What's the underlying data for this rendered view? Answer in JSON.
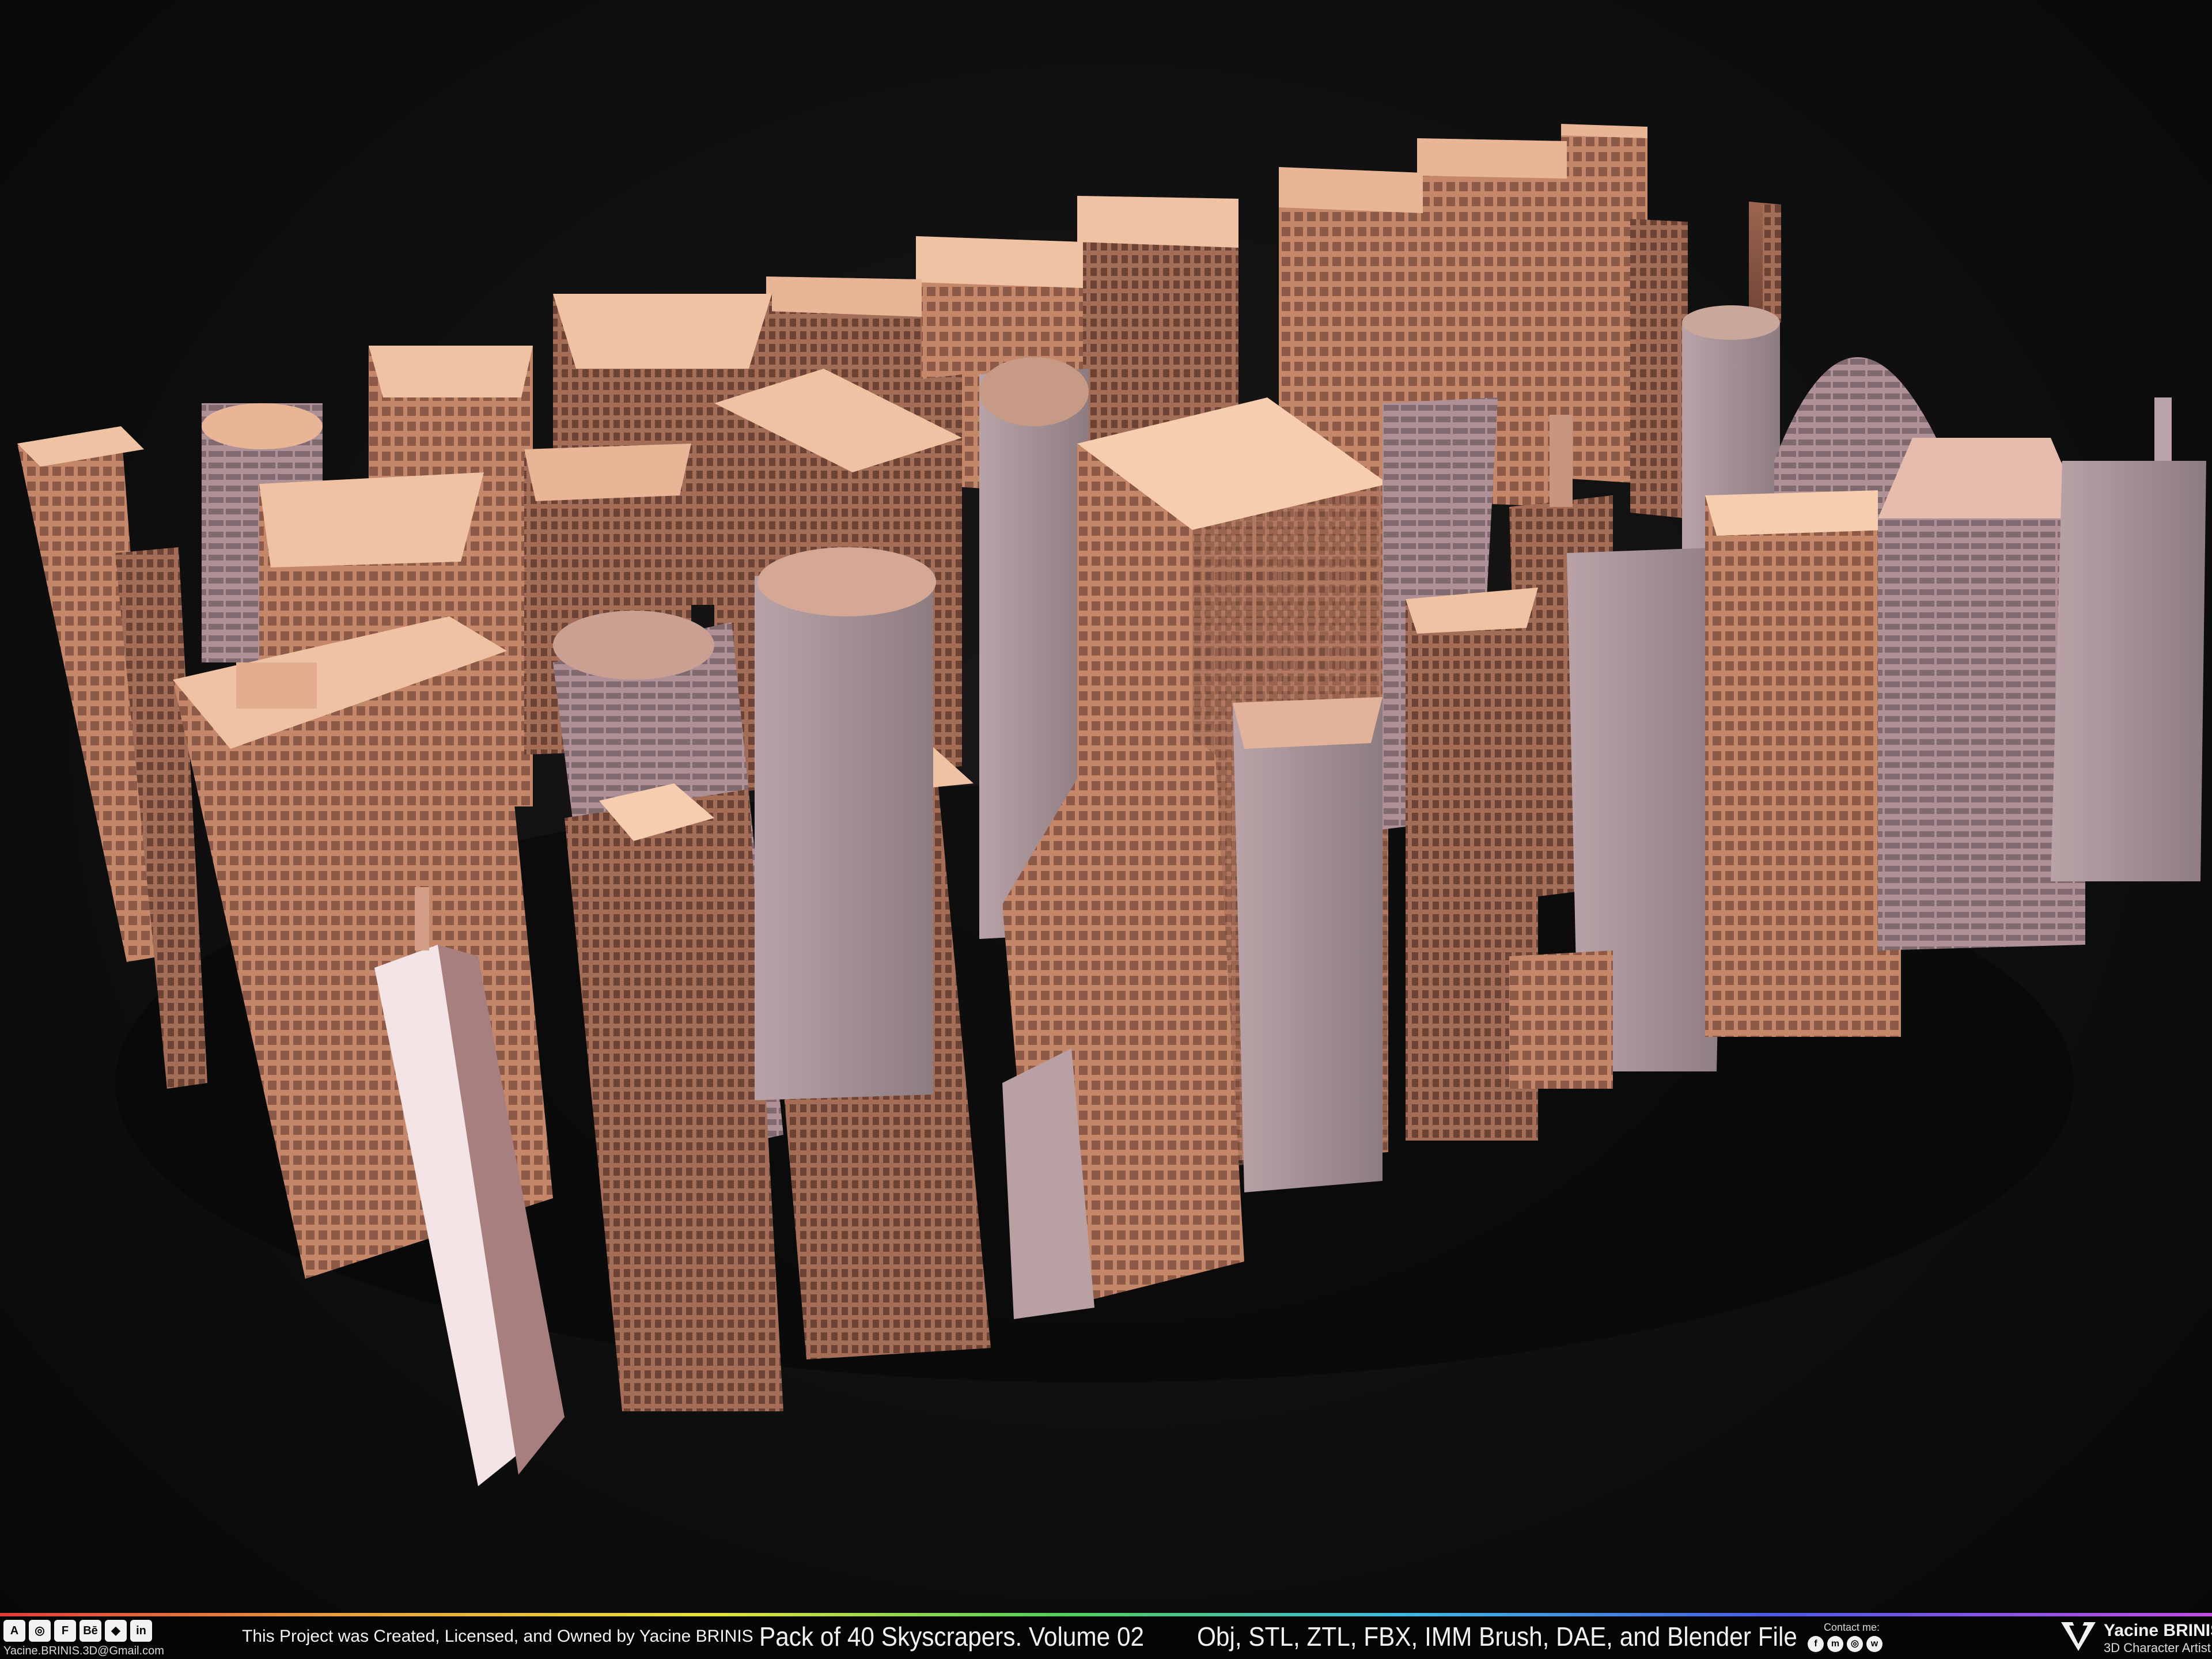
{
  "footer": {
    "credit": "This Project was Created, Licensed, and Owned by Yacine BRINIS",
    "title": "Pack of 40 Skyscrapers. Volume 02",
    "formats": "Obj, STL, ZTL, FBX, IMM Brush, DAE, and Blender File",
    "email": "Yacine.BRINIS.3D@Gmail.com",
    "contact_label": "Contact me:",
    "brand_name": "Yacine BRINIS",
    "brand_subtitle": "3D Character Artist",
    "software_icons": [
      "artstation-icon",
      "cgtrader-icon",
      "fab-icon",
      "behance-icon",
      "sketchfab-icon",
      "linkedin-icon"
    ],
    "social_icons": [
      "facebook-icon",
      "messenger-icon",
      "instagram-icon",
      "whatsapp-icon"
    ]
  },
  "scene": {
    "subject": "skyscraper-models",
    "building_color": "#c88a6e",
    "building_highlight": "#f0c2a4",
    "building_shadow": "#7a4f40",
    "background_color": "#0e0d0d"
  }
}
